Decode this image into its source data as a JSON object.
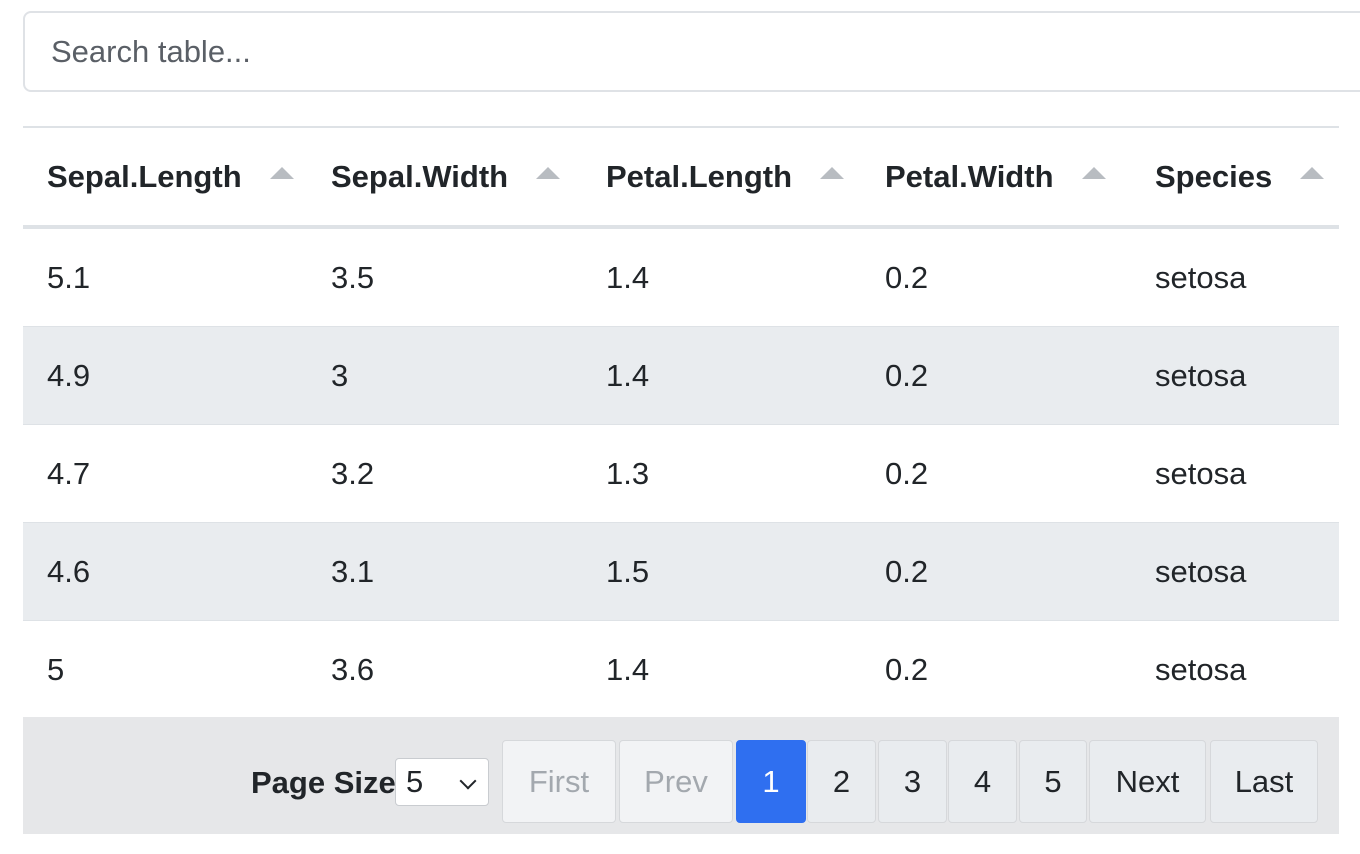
{
  "search": {
    "placeholder": "Search table..."
  },
  "table": {
    "columns": [
      "Sepal.Length",
      "Sepal.Width",
      "Petal.Length",
      "Petal.Width",
      "Species"
    ],
    "rows": [
      [
        "5.1",
        "3.5",
        "1.4",
        "0.2",
        "setosa"
      ],
      [
        "4.9",
        "3",
        "1.4",
        "0.2",
        "setosa"
      ],
      [
        "4.7",
        "3.2",
        "1.3",
        "0.2",
        "setosa"
      ],
      [
        "4.6",
        "3.1",
        "1.5",
        "0.2",
        "setosa"
      ],
      [
        "5",
        "3.6",
        "1.4",
        "0.2",
        "setosa"
      ]
    ],
    "sort_icon": "sort-up-icon"
  },
  "footer": {
    "page_size_label": "Page Size",
    "page_size_value": "5",
    "first_label": "First",
    "prev_label": "Prev",
    "pages": [
      "1",
      "2",
      "3",
      "4",
      "5"
    ],
    "current_page": "1",
    "next_label": "Next",
    "last_label": "Last"
  },
  "colors": {
    "active_page": "#2f6ff0",
    "striped_row": "#e9ecef",
    "footer_bg": "#e6e7e9"
  }
}
